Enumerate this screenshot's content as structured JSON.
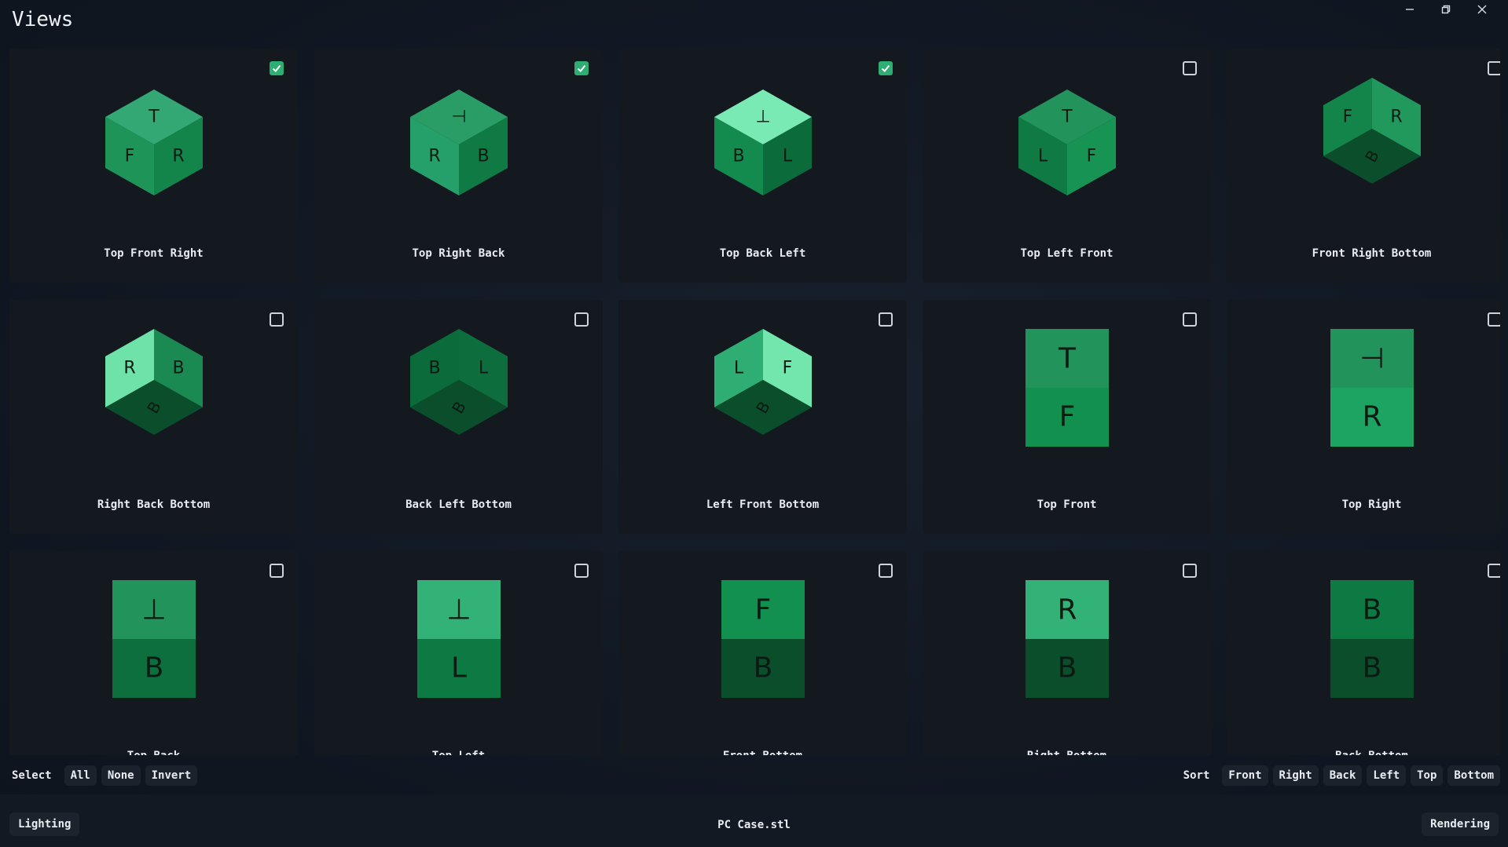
{
  "window": {
    "title": "Views"
  },
  "views": [
    {
      "label": "Top Front Right",
      "checked": true,
      "kind": "cube",
      "faces": {
        "top": "T",
        "left": "F",
        "right": "R"
      },
      "shades": {
        "top": "#33a874",
        "left": "#1f9458",
        "right": "#13844a"
      }
    },
    {
      "label": "Top Right Back",
      "checked": true,
      "kind": "cube",
      "faces": {
        "top": "⊣",
        "left": "R",
        "right": "B"
      },
      "shades": {
        "top": "#2a9d66",
        "left": "#26a06a",
        "right": "#0f7a44"
      }
    },
    {
      "label": "Top Back Left",
      "checked": true,
      "kind": "cube",
      "faces": {
        "top": "⊥",
        "left": "B",
        "right": "L"
      },
      "shades": {
        "top": "#7aeab4",
        "left": "#138b4e",
        "right": "#0b6b3a"
      }
    },
    {
      "label": "Top Left Front",
      "checked": false,
      "kind": "cube",
      "faces": {
        "top": "T",
        "left": "L",
        "right": "F"
      },
      "shades": {
        "top": "#23935c",
        "left": "#0f7a44",
        "right": "#179354"
      }
    },
    {
      "label": "Front Right Bottom",
      "checked": false,
      "kind": "cube-bottom",
      "faces": {
        "left": "F",
        "right": "R",
        "bottom": "B"
      },
      "shades": {
        "left": "#13844a",
        "right": "#21995d",
        "bottom": "#0a4e2b"
      }
    },
    {
      "label": "Right Back Bottom",
      "checked": false,
      "kind": "cube-bottom",
      "faces": {
        "left": "R",
        "right": "B",
        "bottom": "B"
      },
      "shades": {
        "left": "#6ee2a8",
        "right": "#1b8a52",
        "bottom": "#0a4e2b"
      }
    },
    {
      "label": "Back Left Bottom",
      "checked": false,
      "kind": "cube-bottom",
      "faces": {
        "left": "B",
        "right": "L",
        "bottom": "B"
      },
      "shades": {
        "left": "#0b6b3a",
        "right": "#0e6d3c",
        "bottom": "#0a4e2b"
      }
    },
    {
      "label": "Left Front Bottom",
      "checked": false,
      "kind": "cube-bottom",
      "faces": {
        "left": "L",
        "right": "F",
        "bottom": "B"
      },
      "shades": {
        "left": "#2fae73",
        "right": "#73e6ad",
        "bottom": "#0a4e2b"
      }
    },
    {
      "label": "Top Front",
      "checked": false,
      "kind": "pair",
      "faces": {
        "upper": "T",
        "lower": "F"
      },
      "shades": {
        "upper": "#23935c",
        "lower": "#129050"
      }
    },
    {
      "label": "Top Right",
      "checked": false,
      "kind": "pair",
      "faces": {
        "upper": "⊣",
        "lower": "R"
      },
      "shades": {
        "upper": "#23935c",
        "lower": "#1da463"
      }
    },
    {
      "label": "Top Back",
      "checked": false,
      "kind": "pair",
      "faces": {
        "upper": "⊥",
        "lower": "B"
      },
      "shades": {
        "upper": "#23935c",
        "lower": "#0c6f3d"
      }
    },
    {
      "label": "Top Left",
      "checked": false,
      "kind": "pair",
      "faces": {
        "upper": "⊥",
        "lower": "L"
      },
      "shades": {
        "upper": "#33b277",
        "lower": "#0e7a43"
      }
    },
    {
      "label": "Front Bottom",
      "checked": false,
      "kind": "pair",
      "faces": {
        "upper": "F",
        "lower": "B"
      },
      "shades": {
        "upper": "#129050",
        "lower": "#0a4e2b"
      }
    },
    {
      "label": "Right Bottom",
      "checked": false,
      "kind": "pair",
      "faces": {
        "upper": "R",
        "lower": "B"
      },
      "shades": {
        "upper": "#33b277",
        "lower": "#0a4e2b"
      }
    },
    {
      "label": "Back Bottom",
      "checked": false,
      "kind": "pair",
      "faces": {
        "upper": "B",
        "lower": "B"
      },
      "shades": {
        "upper": "#0e7a43",
        "lower": "#0a4e2b"
      }
    }
  ],
  "select_bar": {
    "select_label": "Select",
    "select_buttons": [
      "All",
      "None",
      "Invert"
    ],
    "sort_label": "Sort",
    "sort_buttons": [
      "Front",
      "Right",
      "Back",
      "Left",
      "Top",
      "Bottom"
    ]
  },
  "status_bar": {
    "left_button": "Lighting",
    "filename": "PC Case.stl",
    "right_button": "Rendering"
  },
  "colors": {
    "accent": "#2fae73",
    "card": "#141920",
    "background": "#111823"
  }
}
